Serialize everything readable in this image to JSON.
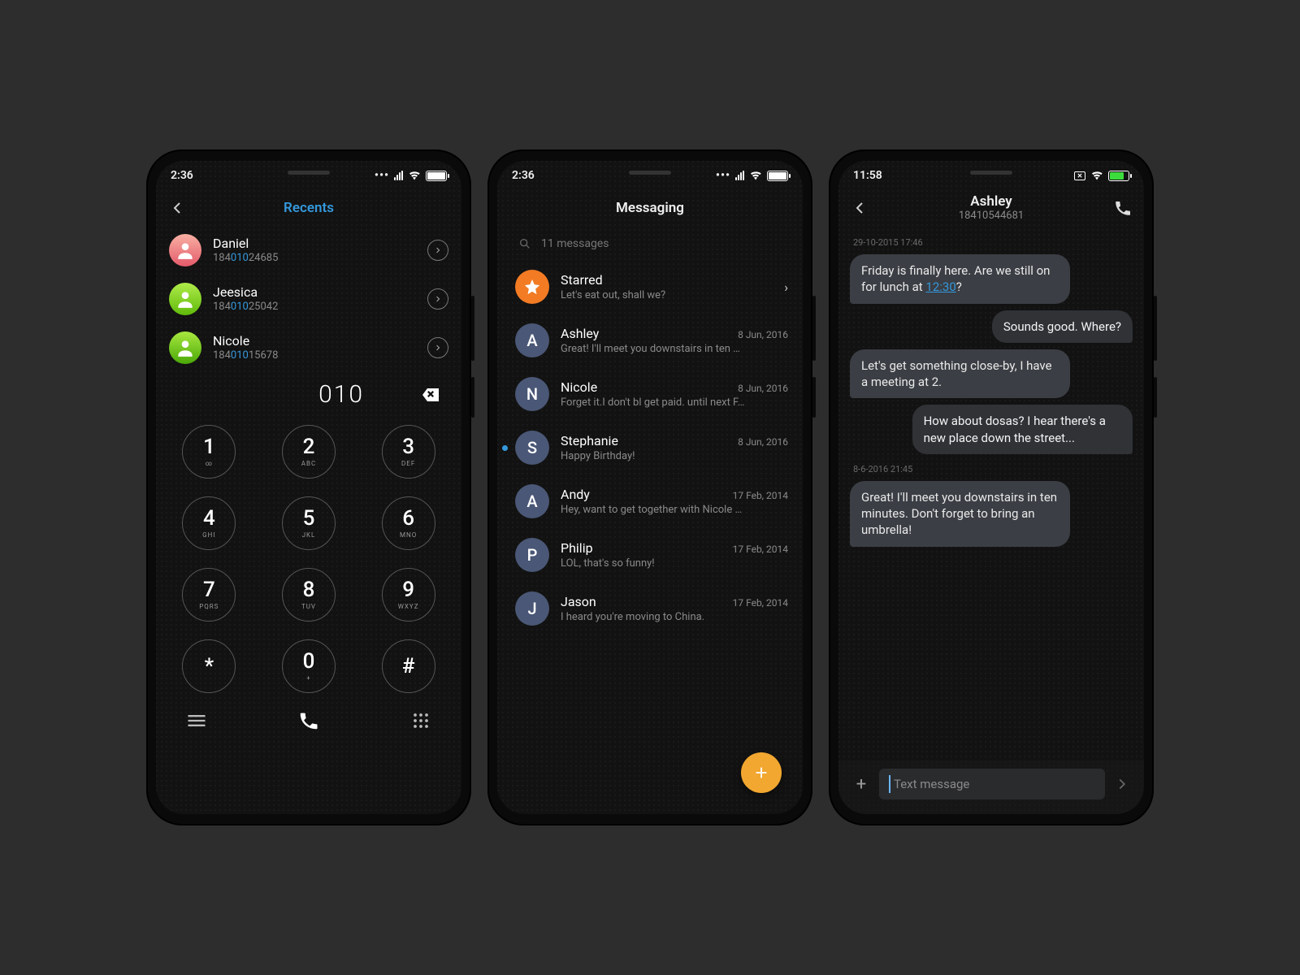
{
  "phone1": {
    "time": "2:36",
    "header": "Recents",
    "contacts": [
      {
        "name": "Daniel",
        "pre": "184",
        "hl": "010",
        "post": "24685"
      },
      {
        "name": "Jeesica",
        "pre": "184",
        "hl": "010",
        "post": "25042"
      },
      {
        "name": "Nicole",
        "pre": "184",
        "hl": "010",
        "post": "15678"
      }
    ],
    "dial_display": "010",
    "keys": [
      {
        "d": "1",
        "l": "∞"
      },
      {
        "d": "2",
        "l": "ABC"
      },
      {
        "d": "3",
        "l": "DEF"
      },
      {
        "d": "4",
        "l": "GHI"
      },
      {
        "d": "5",
        "l": "JKL"
      },
      {
        "d": "6",
        "l": "MNO"
      },
      {
        "d": "7",
        "l": "PQRS"
      },
      {
        "d": "8",
        "l": "TUV"
      },
      {
        "d": "9",
        "l": "WXYZ"
      },
      {
        "d": "*",
        "l": ""
      },
      {
        "d": "0",
        "l": "+"
      },
      {
        "d": "#",
        "l": ""
      }
    ]
  },
  "phone2": {
    "time": "2:36",
    "header": "Messaging",
    "search": "11 messages",
    "threads": [
      {
        "initial": "★",
        "name": "Starred",
        "preview": "Let's eat out, shall we?",
        "date": "",
        "star": true,
        "chev": true
      },
      {
        "initial": "A",
        "name": "Ashley",
        "preview": "Great! I'll meet you downstairs in ten …",
        "date": "8 Jun, 2016"
      },
      {
        "initial": "N",
        "name": "Nicole",
        "preview": "Forget it.I don't bl get paid. until next F…",
        "date": "8 Jun, 2016"
      },
      {
        "initial": "S",
        "name": "Stephanie",
        "preview": "Happy Birthday!",
        "date": "8 Jun, 2016",
        "unread": true
      },
      {
        "initial": "A",
        "name": "Andy",
        "preview": "Hey, want to get together with Nicole …",
        "date": "17 Feb, 2014"
      },
      {
        "initial": "P",
        "name": "Philip",
        "preview": "LOL, that's so funny!",
        "date": "17 Feb, 2014"
      },
      {
        "initial": "J",
        "name": "Jason",
        "preview": "I heard you're moving to China.",
        "date": "17 Feb, 2014"
      }
    ]
  },
  "phone3": {
    "time": "11:58",
    "title": "Ashley",
    "subtitle": "18410544681",
    "groups": [
      {
        "ts": "29-10-2015 17:46",
        "msgs": [
          {
            "dir": "in",
            "text_a": "Friday is finally here. Are we still on for lunch at ",
            "link": "12:30",
            "text_b": "?"
          },
          {
            "dir": "out",
            "text": "Sounds good. Where?"
          },
          {
            "dir": "in",
            "text": "Let's get something close-by, I have a meeting at 2."
          },
          {
            "dir": "out",
            "text": "How about dosas? I hear there's a new place down the street..."
          }
        ]
      },
      {
        "ts": "8-6-2016 21:45",
        "msgs": [
          {
            "dir": "in",
            "text": "Great! I'll meet you downstairs in ten minutes. Don't forget to bring an umbrella!"
          }
        ]
      }
    ],
    "composer_placeholder": "Text message"
  }
}
